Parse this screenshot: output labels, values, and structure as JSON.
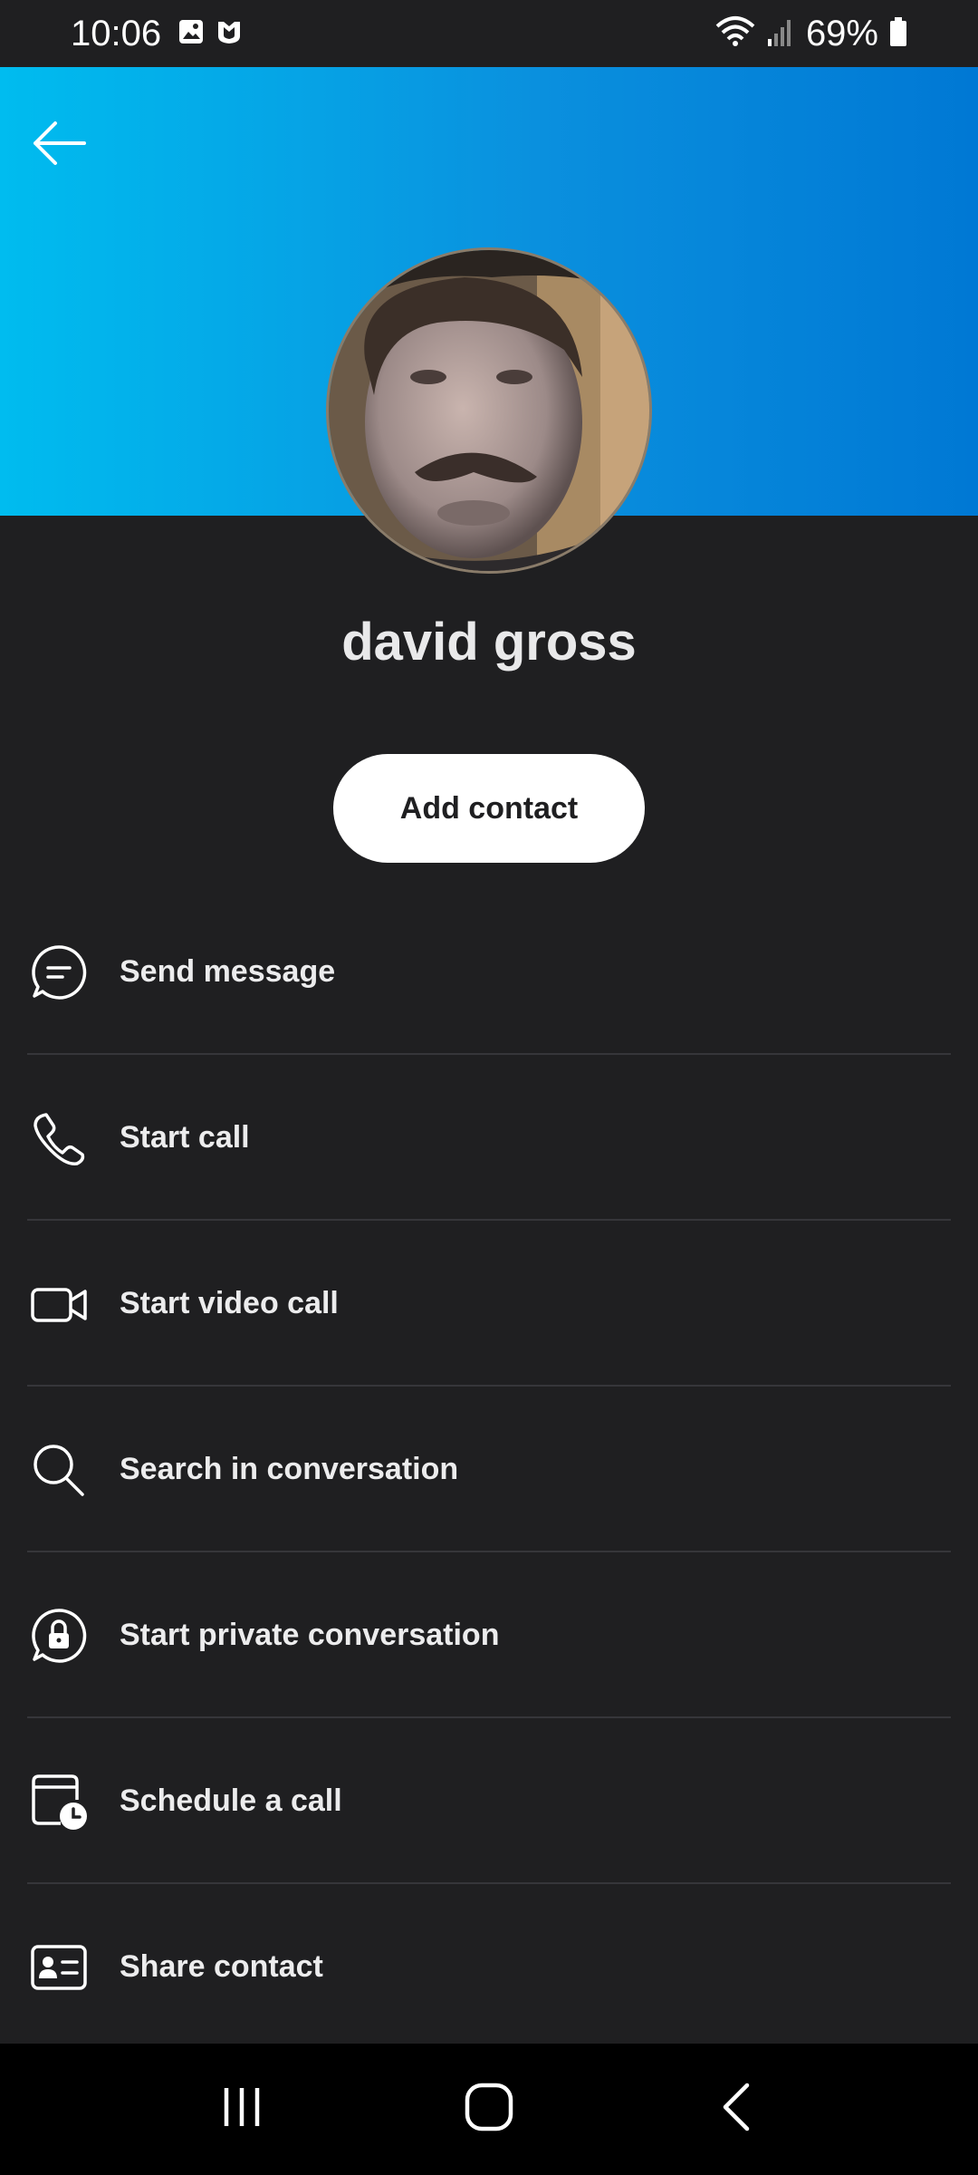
{
  "status_bar": {
    "time": "10:06",
    "battery": "69%",
    "icons": [
      "gallery-icon",
      "shield-app-icon",
      "wifi-icon",
      "signal-icon",
      "battery-icon"
    ]
  },
  "header": {
    "back_icon": "back-arrow-icon",
    "gradient_colors": [
      "#00bcef",
      "#0078d4"
    ]
  },
  "profile": {
    "name": "david gross",
    "avatar": "profile-photo"
  },
  "primary_action": {
    "label": "Add contact"
  },
  "actions": [
    {
      "label": "Send message",
      "icon": "chat-bubble-icon"
    },
    {
      "label": "Start call",
      "icon": "phone-icon"
    },
    {
      "label": "Start video call",
      "icon": "video-camera-icon"
    },
    {
      "label": "Search in conversation",
      "icon": "search-icon"
    },
    {
      "label": "Start private conversation",
      "icon": "lock-chat-icon"
    },
    {
      "label": "Schedule a call",
      "icon": "calendar-clock-icon"
    },
    {
      "label": "Share contact",
      "icon": "contact-card-icon"
    }
  ],
  "nav_bar": {
    "buttons": [
      "recent-apps-icon",
      "home-icon",
      "back-icon"
    ]
  }
}
